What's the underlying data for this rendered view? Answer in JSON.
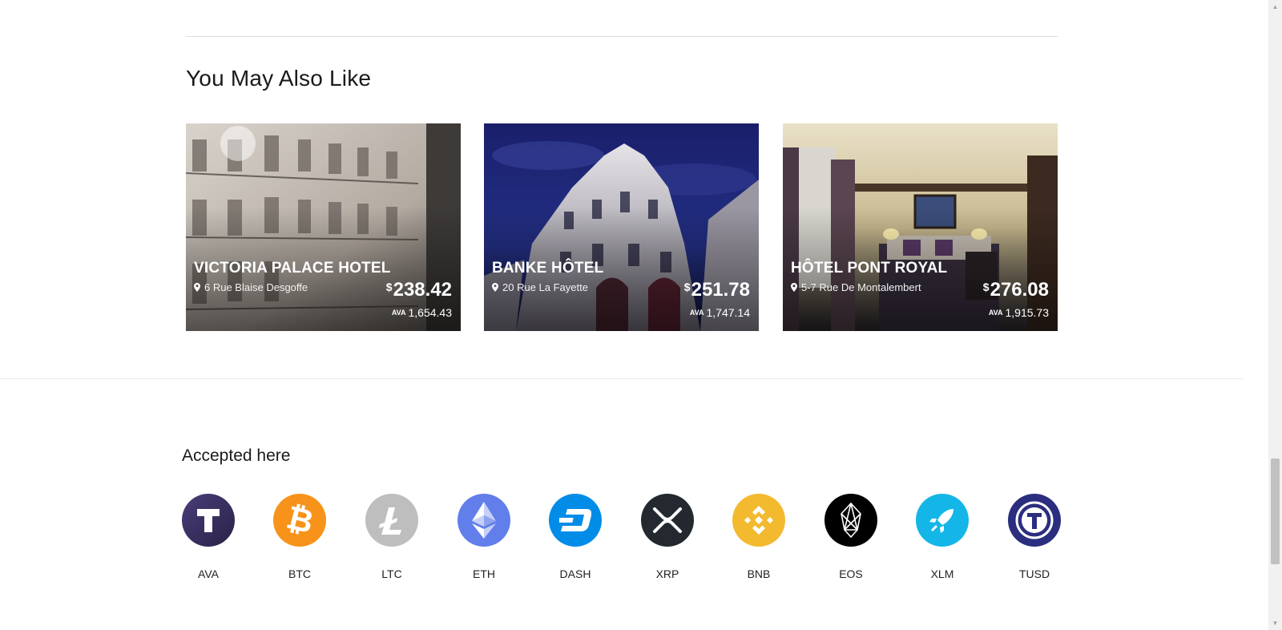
{
  "section": {
    "title": "You May Also Like"
  },
  "hotels": [
    {
      "name": "VICTORIA PALACE HOTEL",
      "address": "6 Rue Blaise Desgoffe",
      "currency": "$",
      "price": "238.42",
      "ava_label": "AVA",
      "ava_price": "1,654.43"
    },
    {
      "name": "BANKE HÔTEL",
      "address": "20 Rue La Fayette",
      "currency": "$",
      "price": "251.78",
      "ava_label": "AVA",
      "ava_price": "1,747.14"
    },
    {
      "name": "HÔTEL PONT ROYAL",
      "address": "5-7 Rue De Montalembert",
      "currency": "$",
      "price": "276.08",
      "ava_label": "AVA",
      "ava_price": "1,915.73"
    }
  ],
  "accepted": {
    "title": "Accepted here",
    "coins": [
      {
        "symbol": "AVA",
        "icon": "ava-coin-icon",
        "color": "#3b2f63"
      },
      {
        "symbol": "BTC",
        "icon": "bitcoin-icon",
        "color": "#f7931a"
      },
      {
        "symbol": "LTC",
        "icon": "litecoin-icon",
        "color": "#bebebe"
      },
      {
        "symbol": "ETH",
        "icon": "ethereum-icon",
        "color": "#627eea"
      },
      {
        "symbol": "DASH",
        "icon": "dash-icon",
        "color": "#008ce7"
      },
      {
        "symbol": "XRP",
        "icon": "xrp-icon",
        "color": "#23292f"
      },
      {
        "symbol": "BNB",
        "icon": "binance-icon",
        "color": "#f3ba2f"
      },
      {
        "symbol": "EOS",
        "icon": "eos-icon",
        "color": "#000000"
      },
      {
        "symbol": "XLM",
        "icon": "stellar-rocket-icon",
        "color": "#14b6e7"
      },
      {
        "symbol": "TUSD",
        "icon": "trueusd-icon",
        "color": "#2b2e7f"
      }
    ]
  }
}
